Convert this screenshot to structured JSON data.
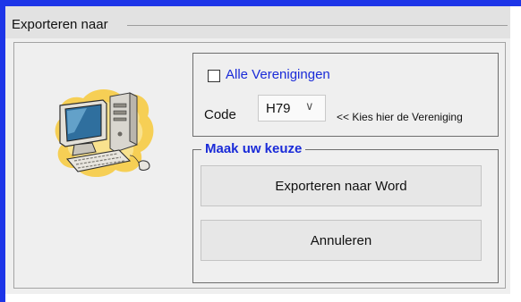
{
  "window": {
    "title_fragment": "",
    "frame_color": "#1d35e8"
  },
  "header": {
    "title": "Exporteren naar"
  },
  "illustration": {
    "icon": "desktop-computer-icon"
  },
  "selection": {
    "all_label": "Alle Verenigingen",
    "all_checked": false,
    "code_label": "Code",
    "code_value": "H79",
    "hint": "<< Kies hier de Vereniging"
  },
  "choice": {
    "legend": "Maak uw keuze",
    "export_word_label": "Exporteren naar Word",
    "cancel_label": "Annuleren"
  },
  "colors": {
    "accent_text": "#1a2bd8",
    "panel_bg": "#efefef"
  }
}
